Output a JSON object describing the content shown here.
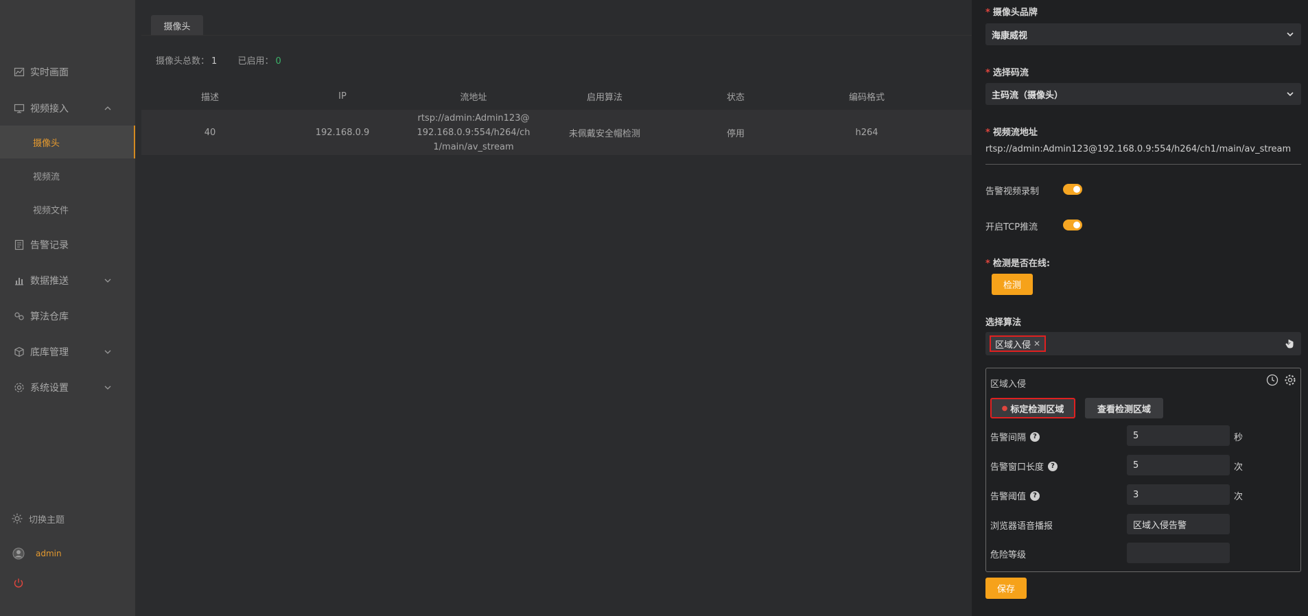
{
  "sidebar": {
    "items": [
      {
        "label": "实时画面",
        "icon": "chart-line-icon"
      },
      {
        "label": "视频接入",
        "icon": "monitor-icon"
      },
      {
        "label": "告警记录",
        "icon": "document-icon"
      },
      {
        "label": "数据推送",
        "icon": "upload-icon"
      },
      {
        "label": "算法仓库",
        "icon": "gear-cluster-icon"
      },
      {
        "label": "底库管理",
        "icon": "box-icon"
      },
      {
        "label": "系统设置",
        "icon": "settings-icon"
      }
    ],
    "sub_items": [
      {
        "label": "摄像头"
      },
      {
        "label": "视频流"
      },
      {
        "label": "视频文件"
      }
    ],
    "theme_label": "切换主题",
    "user_label": "admin"
  },
  "main": {
    "tab_label": "摄像头",
    "stats": {
      "total_label": "摄像头总数：",
      "total_value": "1",
      "enabled_label": "已启用：",
      "enabled_value": "0"
    },
    "table": {
      "headers": [
        "描述",
        "IP",
        "流地址",
        "启用算法",
        "状态",
        "编码格式"
      ],
      "rows": [
        {
          "desc": "40",
          "ip": "192.168.0.9",
          "url_line1": "rtsp://admin:Admin123@",
          "url_line2": "192.168.0.9:554/h264/ch",
          "url_line3": "1/main/av_stream",
          "algorithm": "未佩戴安全帽检测",
          "status": "停用",
          "codec": "h264"
        }
      ]
    }
  },
  "panel": {
    "brand_label": "摄像头品牌",
    "brand_value": "海康威视",
    "stream_label": "选择码流",
    "stream_value": "主码流（摄像头）",
    "url_label": "视频流地址",
    "url_value": "rtsp://admin:Admin123@192.168.0.9:554/h264/ch1/main/av_stream",
    "record_label": "告警视频录制",
    "tcp_label": "开启TCP推流",
    "online_label": "检测是否在线:",
    "detect_button": "检测",
    "algo_label": "选择算法",
    "algo_chip": "区域入侵",
    "algo_box": {
      "title": "区域入侵",
      "mark_button": "标定检测区域",
      "view_button": "查看检测区域",
      "interval_label": "告警间隔",
      "interval_value": "5",
      "interval_unit": "秒",
      "window_label": "告警窗口长度",
      "window_value": "5",
      "window_unit": "次",
      "threshold_label": "告警阈值",
      "threshold_value": "3",
      "threshold_unit": "次",
      "voice_label": "浏览器语音播报",
      "voice_value": "区域入侵告警",
      "risk_label": "危险等级",
      "risk_value": ""
    },
    "save_button": "保存"
  },
  "colors": {
    "accent": "#f6a21a",
    "active_nav": "#e59a2f",
    "enabled_green": "#3cb36a",
    "highlight_red": "#e02020"
  }
}
